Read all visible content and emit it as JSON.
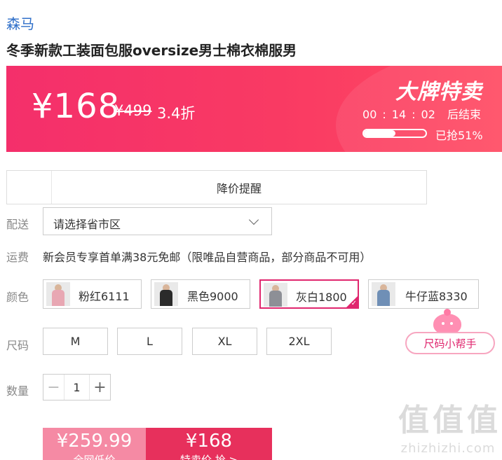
{
  "product": {
    "brand": "森马",
    "title": "冬季新款工装面包服oversize男士棉衣棉服男"
  },
  "promo": {
    "price_now": "¥168",
    "price_original": "¥499",
    "discount": "3.4折",
    "badge": "大牌特卖",
    "countdown": {
      "hours": "00",
      "minutes": "14",
      "seconds": "02",
      "suffix": "后结束",
      "separator": ":"
    },
    "sold_label": "已抢51%",
    "sold_fraction": 0.51
  },
  "price_reminder": {
    "label": "降价提醒"
  },
  "delivery": {
    "label": "配送",
    "placeholder_value": "请选择省市区"
  },
  "shipping": {
    "label": "运费",
    "text": "新会员专享首单满38元免邮（限唯品自营商品，部分商品不可用）"
  },
  "color": {
    "label": "颜色",
    "options": [
      {
        "name": "粉红6111",
        "swatch": "#e8a7b3",
        "selected": false
      },
      {
        "name": "黑色9000",
        "swatch": "#2b2b2b",
        "selected": false
      },
      {
        "name": "灰白1800",
        "swatch": "#8d8f96",
        "selected": true
      },
      {
        "name": "牛仔蓝8330",
        "swatch": "#6f8fb6",
        "selected": false
      }
    ],
    "selected_check_glyph": "✓"
  },
  "size": {
    "label": "尺码",
    "options": [
      "M",
      "L",
      "XL",
      "2XL"
    ],
    "helper_label": "尺码小帮手"
  },
  "quantity": {
    "label": "数量",
    "value": "1",
    "minus": "−",
    "plus": "+"
  },
  "buy": {
    "market_price": "¥259.99",
    "market_label": "全网低价",
    "sale_price": "¥168",
    "sale_label": "特卖价 抢 >"
  },
  "watermark": {
    "glyph": "值",
    "text": "zhizhizhi.com"
  },
  "colors": {
    "accent": "#e0266e",
    "banner": "#f42f6b",
    "brand_link": "#2f6fc9"
  }
}
